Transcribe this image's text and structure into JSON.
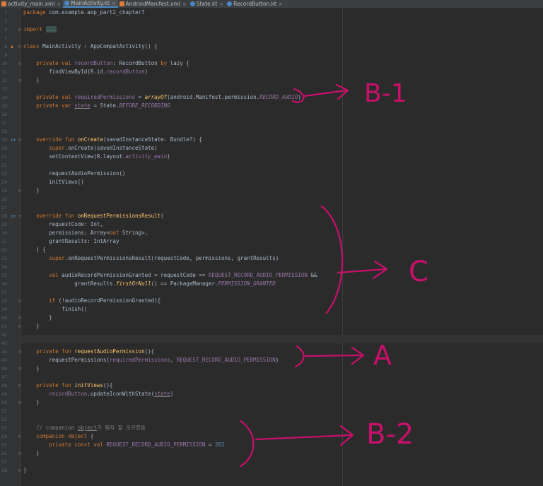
{
  "tabs": [
    {
      "label": "activity_main.xml",
      "icon": "xml-file-icon",
      "color": "#e07b39",
      "active": false
    },
    {
      "label": "MainActivity.kt",
      "icon": "kotlin-file-icon",
      "color": "#4a88c7",
      "active": true
    },
    {
      "label": "AndroidManifest.xml",
      "icon": "xml-file-icon",
      "color": "#e07b39",
      "active": false
    },
    {
      "label": "State.kt",
      "icon": "kotlin-file-icon",
      "color": "#4a88c7",
      "active": false
    },
    {
      "label": "RecordButton.kt",
      "icon": "kotlin-file-icon",
      "color": "#4a88c7",
      "active": false
    }
  ],
  "editor": {
    "line_numbers": [
      "1",
      "2",
      "3",
      "7",
      "8",
      "9",
      "10",
      "11",
      "12",
      "13",
      "14",
      "15",
      "16",
      "17",
      "18",
      "19",
      "20",
      "21",
      "22",
      "23",
      "24",
      "25",
      "26",
      "27",
      "28",
      "29",
      "30",
      "31",
      "32",
      "33",
      "34",
      "35",
      "36",
      "37",
      "38",
      "39",
      "40",
      "41",
      "42",
      "43",
      "44",
      "45",
      "46",
      "47",
      "48",
      "49",
      "50",
      "51",
      "52",
      "53",
      "54",
      "55",
      "56",
      "57",
      "58"
    ],
    "code": {
      "package_kw": "package",
      "package_name": " com.example.aop_part2_chapter7",
      "import_kw": "import",
      "import_folded": "...",
      "class_kw": "class",
      "class_sig": " MainActivity : AppCompatActivity() {",
      "l10_kw": "private val",
      "l10_name": "recordButton",
      "l10_mid": ": RecordButton ",
      "l10_by": "by",
      "l10_lazy": " lazy {",
      "l11_a": "findViewById(R.id.",
      "l11_b": "recordButton",
      "l11_c": ")",
      "close_brace": "}",
      "l14_kw": "private val",
      "l14_name": "requiredPermissions",
      "l14_a": " = ",
      "l14_fn": "arrayOf",
      "l14_b": "(android.Manifest.permission.",
      "l14_c": "RECORD_AUDIO",
      "l14_d": ")",
      "l15_kw": "private var",
      "l15_name": "state",
      "l15_a": " = State.",
      "l15_b": "BEFORE_RECORDING",
      "override_fun": "override fun",
      "l19_fn": "onCreate",
      "l19_rest": "(savedInstanceState: Bundle?) {",
      "super_kw": "super",
      "l20_rest": ".onCreate(savedInstanceState)",
      "l21_a": "setContentView(R.layout.",
      "l21_b": "activity_main",
      "l21_c": ")",
      "l23": "requestAudioPermission()",
      "l24": "initViews()",
      "l28_fn": "onRequestPermissionsResult",
      "l28_rest": "(",
      "l29": "requestCode: Int,",
      "l30_a": "permissions: Array<",
      "l30_out": "out",
      "l30_b": " String>,",
      "l31": "grantResults: IntArray",
      "l32": ") {",
      "l33_rest": ".onRequestPermissionsResult(requestCode, permissions, grantResults)",
      "val_kw": "val",
      "l35_a": " audioRecordPermissionGranted = requestCode == ",
      "l35_b": "REQUEST_RECORD_AUDIO_PERMISSION",
      "l35_c": " &&",
      "l36_a": "grantResults.",
      "l36_fn": "firstOrNull",
      "l36_b": "() == PackageManager.",
      "l36_c": "PERMISSION_GRANTED",
      "if_kw": "if",
      "l38_rest": " (!audioRecordPermissionGranted){",
      "l39": "finish()",
      "private_fun": "private fun",
      "l44_fn": "requestAudioPermission",
      "l44_rest": "(){",
      "l45_a": "requestPermissions(",
      "l45_b": "requiredPermissions",
      "l45_c": ", ",
      "l45_d": "REQUEST_RECORD_AUDIO_PERMISSION",
      "l45_e": ")",
      "l48_fn": "initViews",
      "l48_rest": "(){",
      "l49_a": "recordButton",
      "l49_b": ".updateIconWithState(",
      "l49_c": "state",
      "l49_d": ")",
      "l53_a": "// companion ",
      "l53_b": "object",
      "l53_c": "가 뭔지 잘 모르겠음",
      "l54_kw": "companion object",
      "l54_rest": " {",
      "l55_kw": "private const val",
      "l55_name": " REQUEST_RECORD_AUDIO_PERMISSION",
      "l55_a": " = ",
      "l55_num": "201"
    }
  },
  "annotations": {
    "b1": "B-1",
    "c": "C",
    "a": "A",
    "b2": "B-2",
    "ink_color": "#c8106a"
  }
}
